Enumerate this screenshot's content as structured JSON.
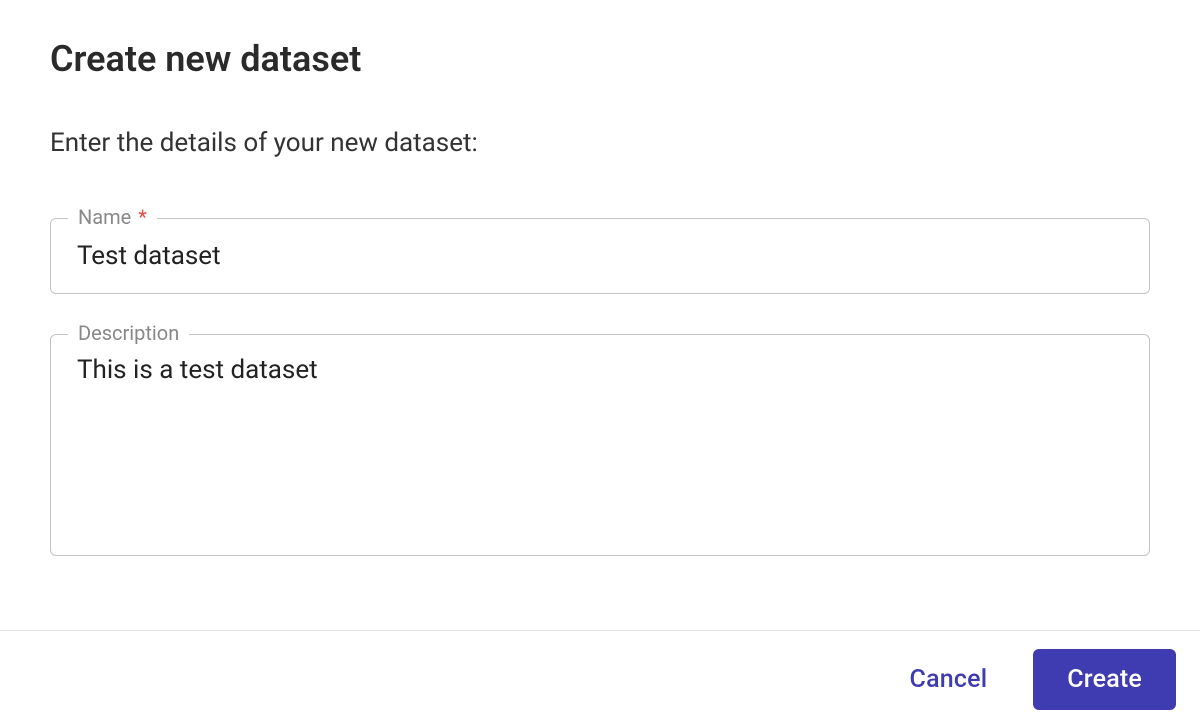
{
  "dialog": {
    "title": "Create new dataset",
    "subtitle": "Enter the details of your new dataset:",
    "fields": {
      "name": {
        "label": "Name",
        "required": true,
        "value": "Test dataset"
      },
      "description": {
        "label": "Description",
        "required": false,
        "value": "This is a test dataset"
      }
    },
    "actions": {
      "cancel_label": "Cancel",
      "create_label": "Create"
    }
  }
}
